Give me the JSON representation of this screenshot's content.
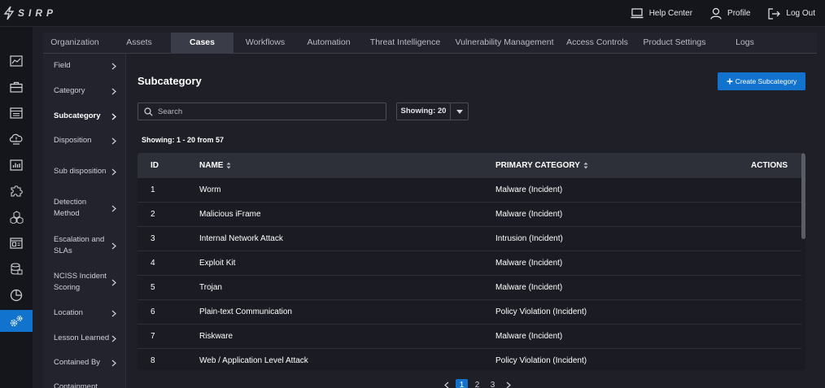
{
  "app": {
    "logo_text": "SIRP"
  },
  "top_links": [
    {
      "label": "Help Center",
      "icon": "laptop-icon"
    },
    {
      "label": "Profile",
      "icon": "user-icon"
    },
    {
      "label": "Log Out",
      "icon": "logout-icon"
    }
  ],
  "rail": {
    "items": [
      "dashboard-icon",
      "briefcase-icon",
      "calendar-icon",
      "cloud-alert-icon",
      "bar-chart-icon",
      "puzzle-icon",
      "cubes-icon",
      "news-icon",
      "database-icon",
      "pie-chart-icon",
      "settings-gears-icon"
    ],
    "active_index": 10
  },
  "tabs": {
    "items": [
      "Organization",
      "Assets",
      "Cases",
      "Workflows",
      "Automation",
      "Threat Intelligence",
      "Vulnerability Management",
      "Access Controls",
      "Product Settings",
      "Logs"
    ],
    "active": "Cases"
  },
  "subnav": {
    "items": [
      "Field",
      "Category",
      "Subcategory",
      "Disposition",
      "Sub disposition",
      "Detection Method",
      "Escalation and SLAs",
      "NCISS Incident Scoring",
      "Location",
      "Lesson Learned",
      "Contained By",
      "Containment"
    ],
    "active": "Subcategory"
  },
  "page": {
    "title": "Subcategory",
    "create_label": "Create Subcategory",
    "search_placeholder": "Search",
    "showing_select": "Showing: 20",
    "showing_count": "Showing: 1 - 20 from 57"
  },
  "table": {
    "columns": {
      "id": "ID",
      "name": "NAME",
      "primary": "PRIMARY CATEGORY",
      "actions": "ACTIONS"
    },
    "rows": [
      {
        "id": "1",
        "name": "Worm",
        "primary": "Malware (Incident)"
      },
      {
        "id": "2",
        "name": "Malicious iFrame",
        "primary": "Malware (Incident)"
      },
      {
        "id": "3",
        "name": "Internal Network Attack",
        "primary": "Intrusion (Incident)"
      },
      {
        "id": "4",
        "name": "Exploit Kit",
        "primary": "Malware (Incident)"
      },
      {
        "id": "5",
        "name": "Trojan",
        "primary": "Malware (Incident)"
      },
      {
        "id": "6",
        "name": "Plain-text Communication",
        "primary": "Policy Violation (Incident)"
      },
      {
        "id": "7",
        "name": "Riskware",
        "primary": "Malware (Incident)"
      },
      {
        "id": "8",
        "name": "Web / Application Level Attack",
        "primary": "Policy Violation (Incident)"
      }
    ]
  },
  "pagination": {
    "pages": [
      "1",
      "2",
      "3"
    ],
    "current": "1"
  },
  "colors": {
    "accent": "#1273cf",
    "background": "#1e1f27",
    "panel": "#22232c"
  }
}
